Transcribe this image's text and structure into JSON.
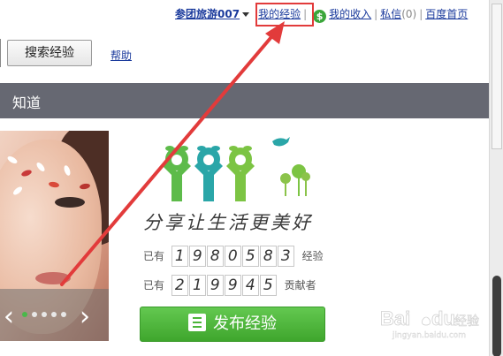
{
  "topbar": {
    "username": "参团旅游007",
    "my_experience": "我的经验",
    "my_income": "我的收入",
    "messages_label": "私信",
    "messages_count": "(0)",
    "baidu_home": "百度首页",
    "separator": "|",
    "coin_symbol": "$"
  },
  "search": {
    "button_label": "搜索经验",
    "help_link": "帮助"
  },
  "nav": {
    "brand": "知道"
  },
  "hero": {
    "slogan": "分享让生活更美好",
    "counters": [
      {
        "prefix": "已有",
        "digits": [
          "1",
          "9",
          "8",
          "0",
          "5",
          "8",
          "3"
        ],
        "suffix": "经验"
      },
      {
        "prefix": "已有",
        "digits": [
          "2",
          "1",
          "9",
          "9",
          "4",
          "5"
        ],
        "suffix": "贡献者"
      }
    ],
    "publish_button": "发布经验",
    "carousel": {
      "prev": "‹",
      "next": "›",
      "slide_count": 5,
      "active_index": 0
    }
  },
  "watermark": {
    "brand": "Bai",
    "brand2": "du",
    "suffix": "经验",
    "url": "jingyan.baidu.com"
  },
  "colors": {
    "link": "#1a3a9c",
    "highlight": "#e23b3b",
    "navbar": "#666872",
    "publish_green": "#4cb53a",
    "logo_green": "#5dbb4a",
    "logo_teal": "#2aa6a8"
  },
  "icons": [
    "coin-icon",
    "caret-down-icon",
    "pencil-icon",
    "bird-icon",
    "tree-icon"
  ]
}
